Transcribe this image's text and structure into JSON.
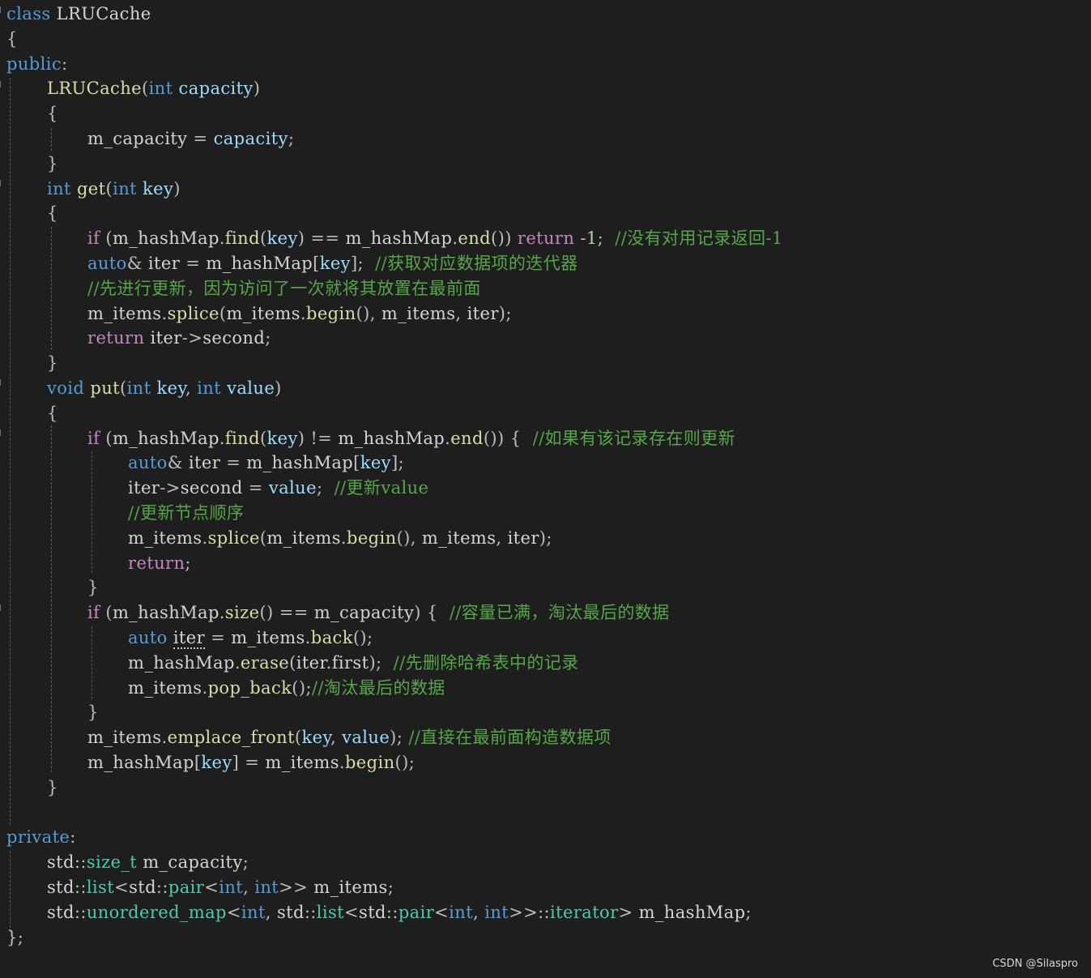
{
  "watermark": "CSDN @Silaspro",
  "colors": {
    "background": "#1e1e1e",
    "keyword": "#569cd6",
    "control": "#c586c0",
    "type": "#4ec9b0",
    "function": "#dcdcaa",
    "variable": "#d4d4d4",
    "parameter": "#9cdcfe",
    "punctuation": "#bdbdbd",
    "number": "#b5cea8",
    "comment": "#57a64a"
  },
  "code": {
    "lines": [
      [
        [
          "kw",
          "class"
        ],
        [
          "var",
          " LRUCache"
        ]
      ],
      [
        [
          "pu",
          "{"
        ]
      ],
      [
        [
          "kw",
          "public"
        ],
        [
          "pu",
          ":"
        ]
      ],
      [
        [
          "fn",
          "LRUCache"
        ],
        [
          "pu",
          "("
        ],
        [
          "kw",
          "int"
        ],
        [
          "par",
          " capacity"
        ],
        [
          "pu",
          ")"
        ]
      ],
      [
        [
          "pu",
          "{"
        ]
      ],
      [
        [
          "var",
          "m_capacity"
        ],
        [
          "pu",
          " = "
        ],
        [
          "par",
          "capacity"
        ],
        [
          "pu",
          ";"
        ]
      ],
      [
        [
          "pu",
          "}"
        ]
      ],
      [
        [
          "kw",
          "int"
        ],
        [
          "fn",
          " get"
        ],
        [
          "pu",
          "("
        ],
        [
          "kw",
          "int"
        ],
        [
          "par",
          " key"
        ],
        [
          "pu",
          ")"
        ]
      ],
      [
        [
          "pu",
          "{"
        ]
      ],
      [
        [
          "ctl",
          "if"
        ],
        [
          "pu",
          " ("
        ],
        [
          "var",
          "m_hashMap"
        ],
        [
          "pu",
          "."
        ],
        [
          "fn",
          "find"
        ],
        [
          "pu",
          "("
        ],
        [
          "par",
          "key"
        ],
        [
          "pu",
          ") == "
        ],
        [
          "var",
          "m_hashMap"
        ],
        [
          "pu",
          "."
        ],
        [
          "fn",
          "end"
        ],
        [
          "pu",
          "()) "
        ],
        [
          "ctl",
          "return"
        ],
        [
          "pu",
          " -"
        ],
        [
          "num",
          "1"
        ],
        [
          "pu",
          ";  "
        ],
        [
          "cm",
          "//没有对用记录返回-1"
        ]
      ],
      [
        [
          "kw",
          "auto"
        ],
        [
          "pu",
          "& "
        ],
        [
          "var",
          "iter"
        ],
        [
          "pu",
          " = "
        ],
        [
          "var",
          "m_hashMap"
        ],
        [
          "pu",
          "["
        ],
        [
          "par",
          "key"
        ],
        [
          "pu",
          "];  "
        ],
        [
          "cm",
          "//获取对应数据项的迭代器"
        ]
      ],
      [
        [
          "cm",
          "//先进行更新，因为访问了一次就将其放置在最前面"
        ]
      ],
      [
        [
          "var",
          "m_items"
        ],
        [
          "pu",
          "."
        ],
        [
          "fn",
          "splice"
        ],
        [
          "pu",
          "("
        ],
        [
          "var",
          "m_items"
        ],
        [
          "pu",
          "."
        ],
        [
          "fn",
          "begin"
        ],
        [
          "pu",
          "(), "
        ],
        [
          "var",
          "m_items"
        ],
        [
          "pu",
          ", "
        ],
        [
          "var",
          "iter"
        ],
        [
          "pu",
          ");"
        ]
      ],
      [
        [
          "ctl",
          "return"
        ],
        [
          "var",
          " iter"
        ],
        [
          "pu",
          "->"
        ],
        [
          "var",
          "second"
        ],
        [
          "pu",
          ";"
        ]
      ],
      [
        [
          "pu",
          "}"
        ]
      ],
      [
        [
          "kw",
          "void"
        ],
        [
          "fn",
          " put"
        ],
        [
          "pu",
          "("
        ],
        [
          "kw",
          "int"
        ],
        [
          "par",
          " key"
        ],
        [
          "pu",
          ", "
        ],
        [
          "kw",
          "int"
        ],
        [
          "par",
          " value"
        ],
        [
          "pu",
          ")"
        ]
      ],
      [
        [
          "pu",
          "{"
        ]
      ],
      [
        [
          "ctl",
          "if"
        ],
        [
          "pu",
          " ("
        ],
        [
          "var",
          "m_hashMap"
        ],
        [
          "pu",
          "."
        ],
        [
          "fn",
          "find"
        ],
        [
          "pu",
          "("
        ],
        [
          "par",
          "key"
        ],
        [
          "pu",
          ") != "
        ],
        [
          "var",
          "m_hashMap"
        ],
        [
          "pu",
          "."
        ],
        [
          "fn",
          "end"
        ],
        [
          "pu",
          "()) {  "
        ],
        [
          "cm",
          "//如果有该记录存在则更新"
        ]
      ],
      [
        [
          "kw",
          "auto"
        ],
        [
          "pu",
          "& "
        ],
        [
          "var",
          "iter"
        ],
        [
          "pu",
          " = "
        ],
        [
          "var",
          "m_hashMap"
        ],
        [
          "pu",
          "["
        ],
        [
          "par",
          "key"
        ],
        [
          "pu",
          "];"
        ]
      ],
      [
        [
          "var",
          "iter"
        ],
        [
          "pu",
          "->"
        ],
        [
          "var",
          "second"
        ],
        [
          "pu",
          " = "
        ],
        [
          "par",
          "value"
        ],
        [
          "pu",
          ";  "
        ],
        [
          "cm",
          "//更新value"
        ]
      ],
      [
        [
          "cm",
          "//更新节点顺序"
        ]
      ],
      [
        [
          "var",
          "m_items"
        ],
        [
          "pu",
          "."
        ],
        [
          "fn",
          "splice"
        ],
        [
          "pu",
          "("
        ],
        [
          "var",
          "m_items"
        ],
        [
          "pu",
          "."
        ],
        [
          "fn",
          "begin"
        ],
        [
          "pu",
          "(), "
        ],
        [
          "var",
          "m_items"
        ],
        [
          "pu",
          ", "
        ],
        [
          "var",
          "iter"
        ],
        [
          "pu",
          ");"
        ]
      ],
      [
        [
          "ctl",
          "return"
        ],
        [
          "pu",
          ";"
        ]
      ],
      [
        [
          "pu",
          "}"
        ]
      ],
      [
        [
          "ctl",
          "if"
        ],
        [
          "pu",
          " ("
        ],
        [
          "var",
          "m_hashMap"
        ],
        [
          "pu",
          "."
        ],
        [
          "fn",
          "size"
        ],
        [
          "pu",
          "() == "
        ],
        [
          "var",
          "m_capacity"
        ],
        [
          "pu",
          ") {  "
        ],
        [
          "cm",
          "//容量已满，淘汰最后的数据"
        ]
      ],
      [
        [
          "kw",
          "auto "
        ],
        [
          "var",
          "iter"
        ],
        [
          "pu",
          " = "
        ],
        [
          "var",
          "m_items"
        ],
        [
          "pu",
          "."
        ],
        [
          "fn",
          "back"
        ],
        [
          "pu",
          "();"
        ]
      ],
      [
        [
          "var",
          "m_hashMap"
        ],
        [
          "pu",
          "."
        ],
        [
          "fn",
          "erase"
        ],
        [
          "pu",
          "("
        ],
        [
          "var",
          "iter"
        ],
        [
          "pu",
          "."
        ],
        [
          "var",
          "first"
        ],
        [
          "pu",
          ");  "
        ],
        [
          "cm",
          "//先删除哈希表中的记录"
        ]
      ],
      [
        [
          "var",
          "m_items"
        ],
        [
          "pu",
          "."
        ],
        [
          "fn",
          "pop_back"
        ],
        [
          "pu",
          "();"
        ],
        [
          "cm",
          "//淘汰最后的数据"
        ]
      ],
      [
        [
          "pu",
          "}"
        ]
      ],
      [
        [
          "var",
          "m_items"
        ],
        [
          "pu",
          "."
        ],
        [
          "fn",
          "emplace_front"
        ],
        [
          "pu",
          "("
        ],
        [
          "par",
          "key"
        ],
        [
          "pu",
          ", "
        ],
        [
          "par",
          "value"
        ],
        [
          "pu",
          "); "
        ],
        [
          "cm",
          "//直接在最前面构造数据项"
        ]
      ],
      [
        [
          "var",
          "m_hashMap"
        ],
        [
          "pu",
          "["
        ],
        [
          "par",
          "key"
        ],
        [
          "pu",
          "] = "
        ],
        [
          "var",
          "m_items"
        ],
        [
          "pu",
          "."
        ],
        [
          "fn",
          "begin"
        ],
        [
          "pu",
          "();"
        ]
      ],
      [
        [
          "pu",
          "}"
        ]
      ],
      [],
      [
        [
          "kw",
          "private"
        ],
        [
          "pu",
          ":"
        ]
      ],
      [
        [
          "var",
          "std"
        ],
        [
          "pu",
          "::"
        ],
        [
          "ty",
          "size_t"
        ],
        [
          "var",
          " m_capacity"
        ],
        [
          "pu",
          ";"
        ]
      ],
      [
        [
          "var",
          "std"
        ],
        [
          "pu",
          "::"
        ],
        [
          "ty",
          "list"
        ],
        [
          "pu",
          "<"
        ],
        [
          "var",
          "std"
        ],
        [
          "pu",
          "::"
        ],
        [
          "ty",
          "pair"
        ],
        [
          "pu",
          "<"
        ],
        [
          "kw",
          "int"
        ],
        [
          "pu",
          ", "
        ],
        [
          "kw",
          "int"
        ],
        [
          "pu",
          ">> "
        ],
        [
          "var",
          "m_items"
        ],
        [
          "pu",
          ";"
        ]
      ],
      [
        [
          "var",
          "std"
        ],
        [
          "pu",
          "::"
        ],
        [
          "ty",
          "unordered_map"
        ],
        [
          "pu",
          "<"
        ],
        [
          "kw",
          "int"
        ],
        [
          "pu",
          ", "
        ],
        [
          "var",
          "std"
        ],
        [
          "pu",
          "::"
        ],
        [
          "ty",
          "list"
        ],
        [
          "pu",
          "<"
        ],
        [
          "var",
          "std"
        ],
        [
          "pu",
          "::"
        ],
        [
          "ty",
          "pair"
        ],
        [
          "pu",
          "<"
        ],
        [
          "kw",
          "int"
        ],
        [
          "pu",
          ", "
        ],
        [
          "kw",
          "int"
        ],
        [
          "pu",
          ">>::"
        ],
        [
          "ty",
          "iterator"
        ],
        [
          "pu",
          "> "
        ],
        [
          "var",
          "m_hashMap"
        ],
        [
          "pu",
          ";"
        ]
      ],
      [
        [
          "pu",
          "};"
        ]
      ]
    ]
  }
}
